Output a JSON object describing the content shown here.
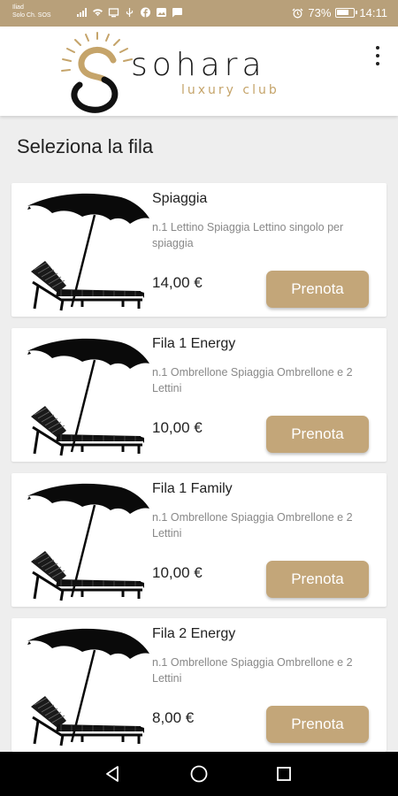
{
  "status_bar": {
    "carrier_line1": "Iliad",
    "carrier_line2": "Solo Ch. SOS",
    "battery": "73%",
    "time": "14:11",
    "icons": [
      "signal-icon",
      "wifi-icon",
      "cast-icon",
      "usb-icon",
      "facebook-icon",
      "image-icon",
      "chat-icon",
      "alarm-icon",
      "battery-icon"
    ]
  },
  "header": {
    "brand_name": "sohara",
    "brand_sub": "luxury club",
    "menu_icon": "more-vert-icon"
  },
  "page": {
    "title": "Seleziona la fila"
  },
  "items": [
    {
      "title": "Spiaggia",
      "description": "n.1 Lettino Spiaggia Lettino singolo per spiaggia",
      "price": "14,00 €",
      "button": "Prenota"
    },
    {
      "title": "Fila 1 Energy",
      "description": "n.1 Ombrellone Spiaggia Ombrellone e 2 Lettini",
      "price": "10,00 €",
      "button": "Prenota"
    },
    {
      "title": "Fila 1 Family",
      "description": "n.1 Ombrellone Spiaggia Ombrellone e 2 Lettini",
      "price": "10,00 €",
      "button": "Prenota"
    },
    {
      "title": "Fila 2 Energy",
      "description": "n.1 Ombrellone Spiaggia Ombrellone e 2 Lettini",
      "price": "8,00 €",
      "button": "Prenota"
    }
  ],
  "colors": {
    "status_bar": "#b8a07a",
    "accent": "#c3a679",
    "logo_gold": "#c5a46a"
  },
  "nav": {
    "icons": [
      "back-icon",
      "home-icon",
      "recents-icon"
    ]
  }
}
